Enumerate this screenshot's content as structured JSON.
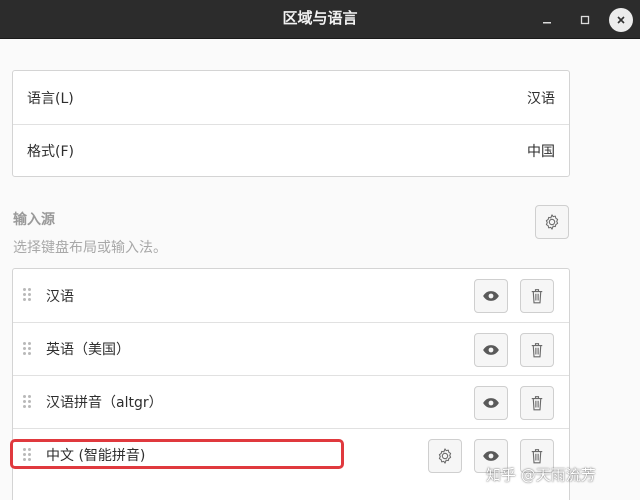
{
  "window": {
    "title": "区域与语言",
    "buttons": {
      "minimize_icon": "minimize-icon",
      "maximize_icon": "maximize-icon",
      "close_icon": "close-icon"
    }
  },
  "region_panel": {
    "rows": [
      {
        "label": "语言(L)",
        "value": "汉语"
      },
      {
        "label": "格式(F)",
        "value": "中国"
      }
    ]
  },
  "input_sources": {
    "title": "输入源",
    "subtitle": "选择键盘布局或输入法。",
    "settings_icon": "gear-icon",
    "items": [
      {
        "label": "汉语"
      },
      {
        "label": "英语（美国）"
      },
      {
        "label": "汉语拼音（altgr）"
      },
      {
        "label": "中文 (智能拼音)"
      }
    ]
  },
  "accent_color": "#e0393e",
  "watermark": "知乎 @天雨流芳"
}
